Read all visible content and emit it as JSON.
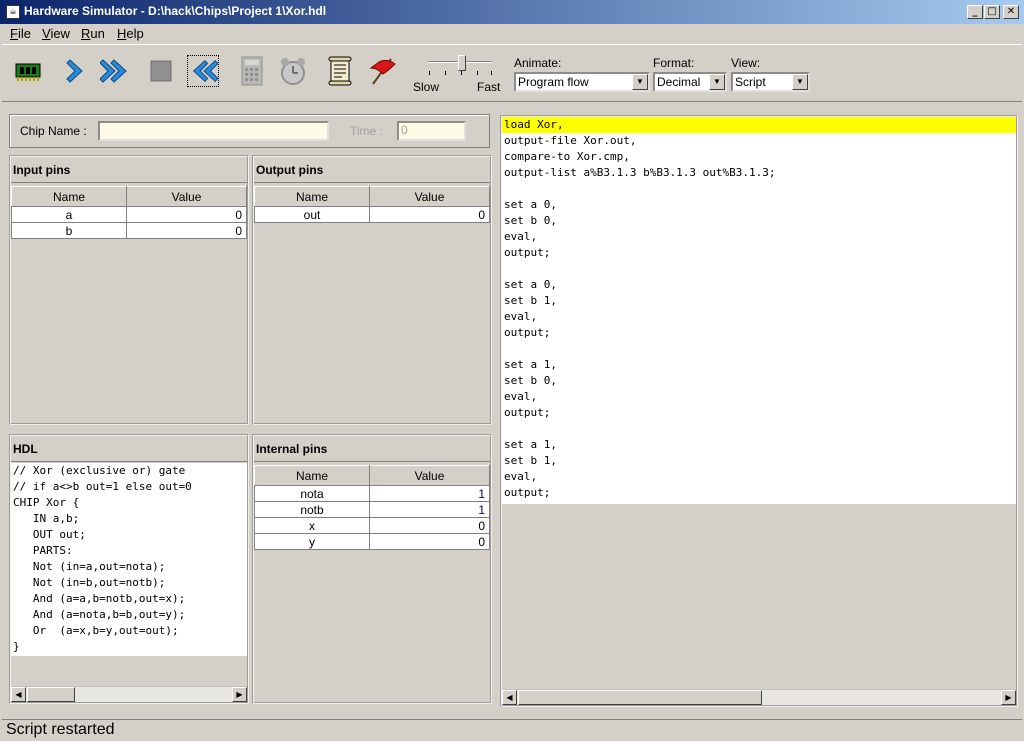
{
  "window": {
    "title": "Hardware Simulator - D:\\hack\\Chips\\Project 1\\Xor.hdl",
    "min": "_",
    "max": "□",
    "close": "✕"
  },
  "menu": {
    "file": "File",
    "view": "View",
    "run": "Run",
    "help": "Help"
  },
  "toolbar": {
    "speed_slow": "Slow",
    "speed_fast": "Fast",
    "animate_label": "Animate:",
    "animate_value": "Program flow",
    "format_label": "Format:",
    "format_value": "Decimal",
    "view_label": "View:",
    "view_value": "Script"
  },
  "chip": {
    "name_label": "Chip Name :",
    "name_value": "",
    "time_label": "Time :",
    "time_value": "0"
  },
  "input_pins": {
    "title": "Input pins",
    "headers": [
      "Name",
      "Value"
    ],
    "rows": [
      {
        "name": "a",
        "value": "0"
      },
      {
        "name": "b",
        "value": "0"
      }
    ]
  },
  "output_pins": {
    "title": "Output pins",
    "headers": [
      "Name",
      "Value"
    ],
    "rows": [
      {
        "name": "out",
        "value": "0"
      }
    ]
  },
  "hdl": {
    "title": "HDL",
    "lines": [
      "// Xor (exclusive or) gate",
      "// if a<>b out=1 else out=0",
      "CHIP Xor {",
      "   IN a,b;",
      "   OUT out;",
      "   PARTS:",
      "   Not (in=a,out=nota);",
      "   Not (in=b,out=notb);",
      "   And (a=a,b=notb,out=x);",
      "   And (a=nota,b=b,out=y);",
      "   Or  (a=x,b=y,out=out);",
      "}"
    ]
  },
  "internal_pins": {
    "title": "Internal pins",
    "headers": [
      "Name",
      "Value"
    ],
    "rows": [
      {
        "name": "nota",
        "value": "1"
      },
      {
        "name": "notb",
        "value": "1"
      },
      {
        "name": "x",
        "value": "0"
      },
      {
        "name": "y",
        "value": "0"
      }
    ]
  },
  "script": {
    "highlight_color": "#ffff00",
    "lines": [
      "load Xor,",
      "output-file Xor.out,",
      "compare-to Xor.cmp,",
      "output-list a%B3.1.3 b%B3.1.3 out%B3.1.3;",
      "",
      "set a 0,",
      "set b 0,",
      "eval,",
      "output;",
      "",
      "set a 0,",
      "set b 1,",
      "eval,",
      "output;",
      "",
      "set a 1,",
      "set b 0,",
      "eval,",
      "output;",
      "",
      "set a 1,",
      "set b 1,",
      "eval,",
      "output;"
    ]
  },
  "status": {
    "text": "Script restarted"
  },
  "icons": {
    "load_chip": "chip-icon",
    "single_step": "single-step-icon",
    "run": "run-icon",
    "stop": "stop-icon",
    "reset": "reset-icon",
    "calculator": "calculator-icon",
    "clock": "clock-icon",
    "script": "script-icon",
    "breakpoint": "flag-icon"
  }
}
